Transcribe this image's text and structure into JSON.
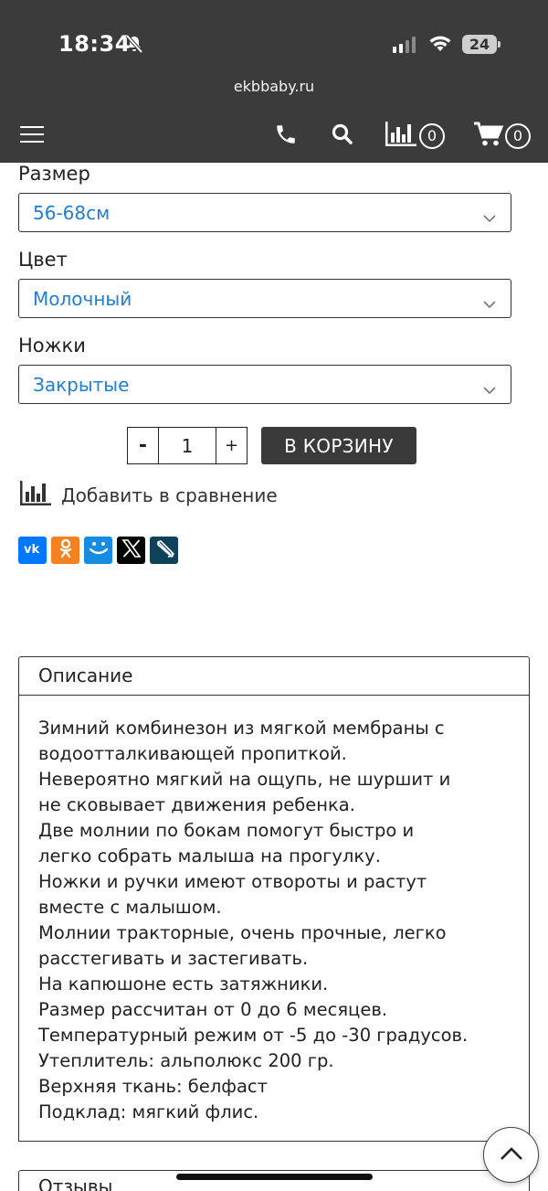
{
  "status_bar": {
    "time": "18:34",
    "battery": "24",
    "icons": [
      "bell-slash-icon",
      "signal-icon",
      "wifi-icon",
      "battery-icon"
    ]
  },
  "browser": {
    "url": "ekbbaby.ru"
  },
  "navbar": {
    "compare_count": "0",
    "cart_count": "0",
    "icons": [
      "menu-icon",
      "phone-icon",
      "search-icon",
      "compare-chart-icon",
      "cart-icon"
    ]
  },
  "options": {
    "size": {
      "label": "Размер",
      "value": "56-68см"
    },
    "color": {
      "label": "Цвет",
      "value": "Молочный"
    },
    "legs": {
      "label": "Ножки",
      "value": "Закрытые"
    }
  },
  "purchase": {
    "minus": "-",
    "quantity": "1",
    "plus": "+",
    "add_to_cart": "В КОРЗИНУ"
  },
  "compare": {
    "label": "Добавить в сравнение"
  },
  "share": [
    {
      "name": "vk",
      "icon": "vk-icon",
      "color": "#0077ff"
    },
    {
      "name": "odnoklassniki",
      "icon": "ok-icon",
      "color": "#f58220"
    },
    {
      "name": "moimir",
      "icon": "moimir-icon",
      "color": "#168de2"
    },
    {
      "name": "x",
      "icon": "x-icon",
      "color": "#000000"
    },
    {
      "name": "livejournal",
      "icon": "livejournal-icon",
      "color": "#0d425a"
    }
  ],
  "description": {
    "tab_label": "Описание",
    "lines": [
      "Зимний комбинезон из мягкой мембраны с",
      "водоотталкивающей пропиткой.",
      "Невероятно мягкий на ощупь, не шуршит и",
      "не сковывает движения ребенка.",
      "Две молнии по бокам помогут быстро и",
      "легко собрать малыша на прогулку.",
      "Ножки и ручки имеют отвороты и растут",
      "вместе с малышом.",
      "Молнии тракторные, очень прочные, легко",
      "расстегивать и застегивать.",
      "На капюшоне есть затяжники.",
      "Размер рассчитан от 0 до 6 месяцев.",
      "Температурный режим от -5 до -30 градусов.",
      "Утеплитель: альполюкс 200 гр.",
      "Верхняя ткань: белфаст",
      "Подклад: мягкий флис."
    ]
  },
  "reviews": {
    "tab_label": "Отзывы"
  }
}
